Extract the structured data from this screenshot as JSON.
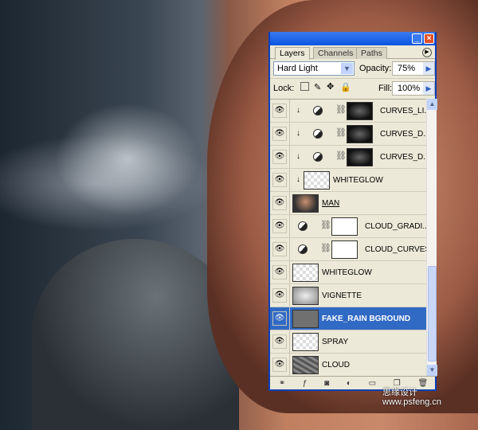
{
  "tabs": [
    "Layers",
    "Channels",
    "Paths"
  ],
  "blend_mode": "Hard Light",
  "opacity_label": "Opacity:",
  "opacity": "75%",
  "lock_label": "Lock:",
  "fill_label": "Fill:",
  "fill": "100%",
  "layers": [
    {
      "name": "CURVES_LI...",
      "clip": true,
      "adj": true,
      "mask": "dark"
    },
    {
      "name": "CURVES_D...",
      "clip": true,
      "adj": true,
      "mask": "dark"
    },
    {
      "name": "CURVES_D...",
      "clip": true,
      "adj": true,
      "mask": "dark"
    },
    {
      "name": "WHITEGLOW",
      "clip": true,
      "thumb": "trans"
    },
    {
      "name": "MAN",
      "thumb": "photo",
      "underline": true
    },
    {
      "name": "CLOUD_GRADI...",
      "adj": true,
      "mask": "white"
    },
    {
      "name": "CLOUD_CURVES",
      "adj": true,
      "mask": "white"
    },
    {
      "name": "WHITEGLOW",
      "thumb": "trans"
    },
    {
      "name": "VIGNETTE",
      "thumb": "vignette"
    },
    {
      "name": "FAKE_RAIN BGROUND",
      "thumb": "grey",
      "selected": true
    },
    {
      "name": "SPRAY",
      "thumb": "trans"
    },
    {
      "name": "CLOUD",
      "thumb": "cloud"
    }
  ],
  "watermark": "思缘设计 www.psfeng.cn",
  "colors": {
    "selection": "#316ac5",
    "titlebar": "#0a55e0"
  }
}
